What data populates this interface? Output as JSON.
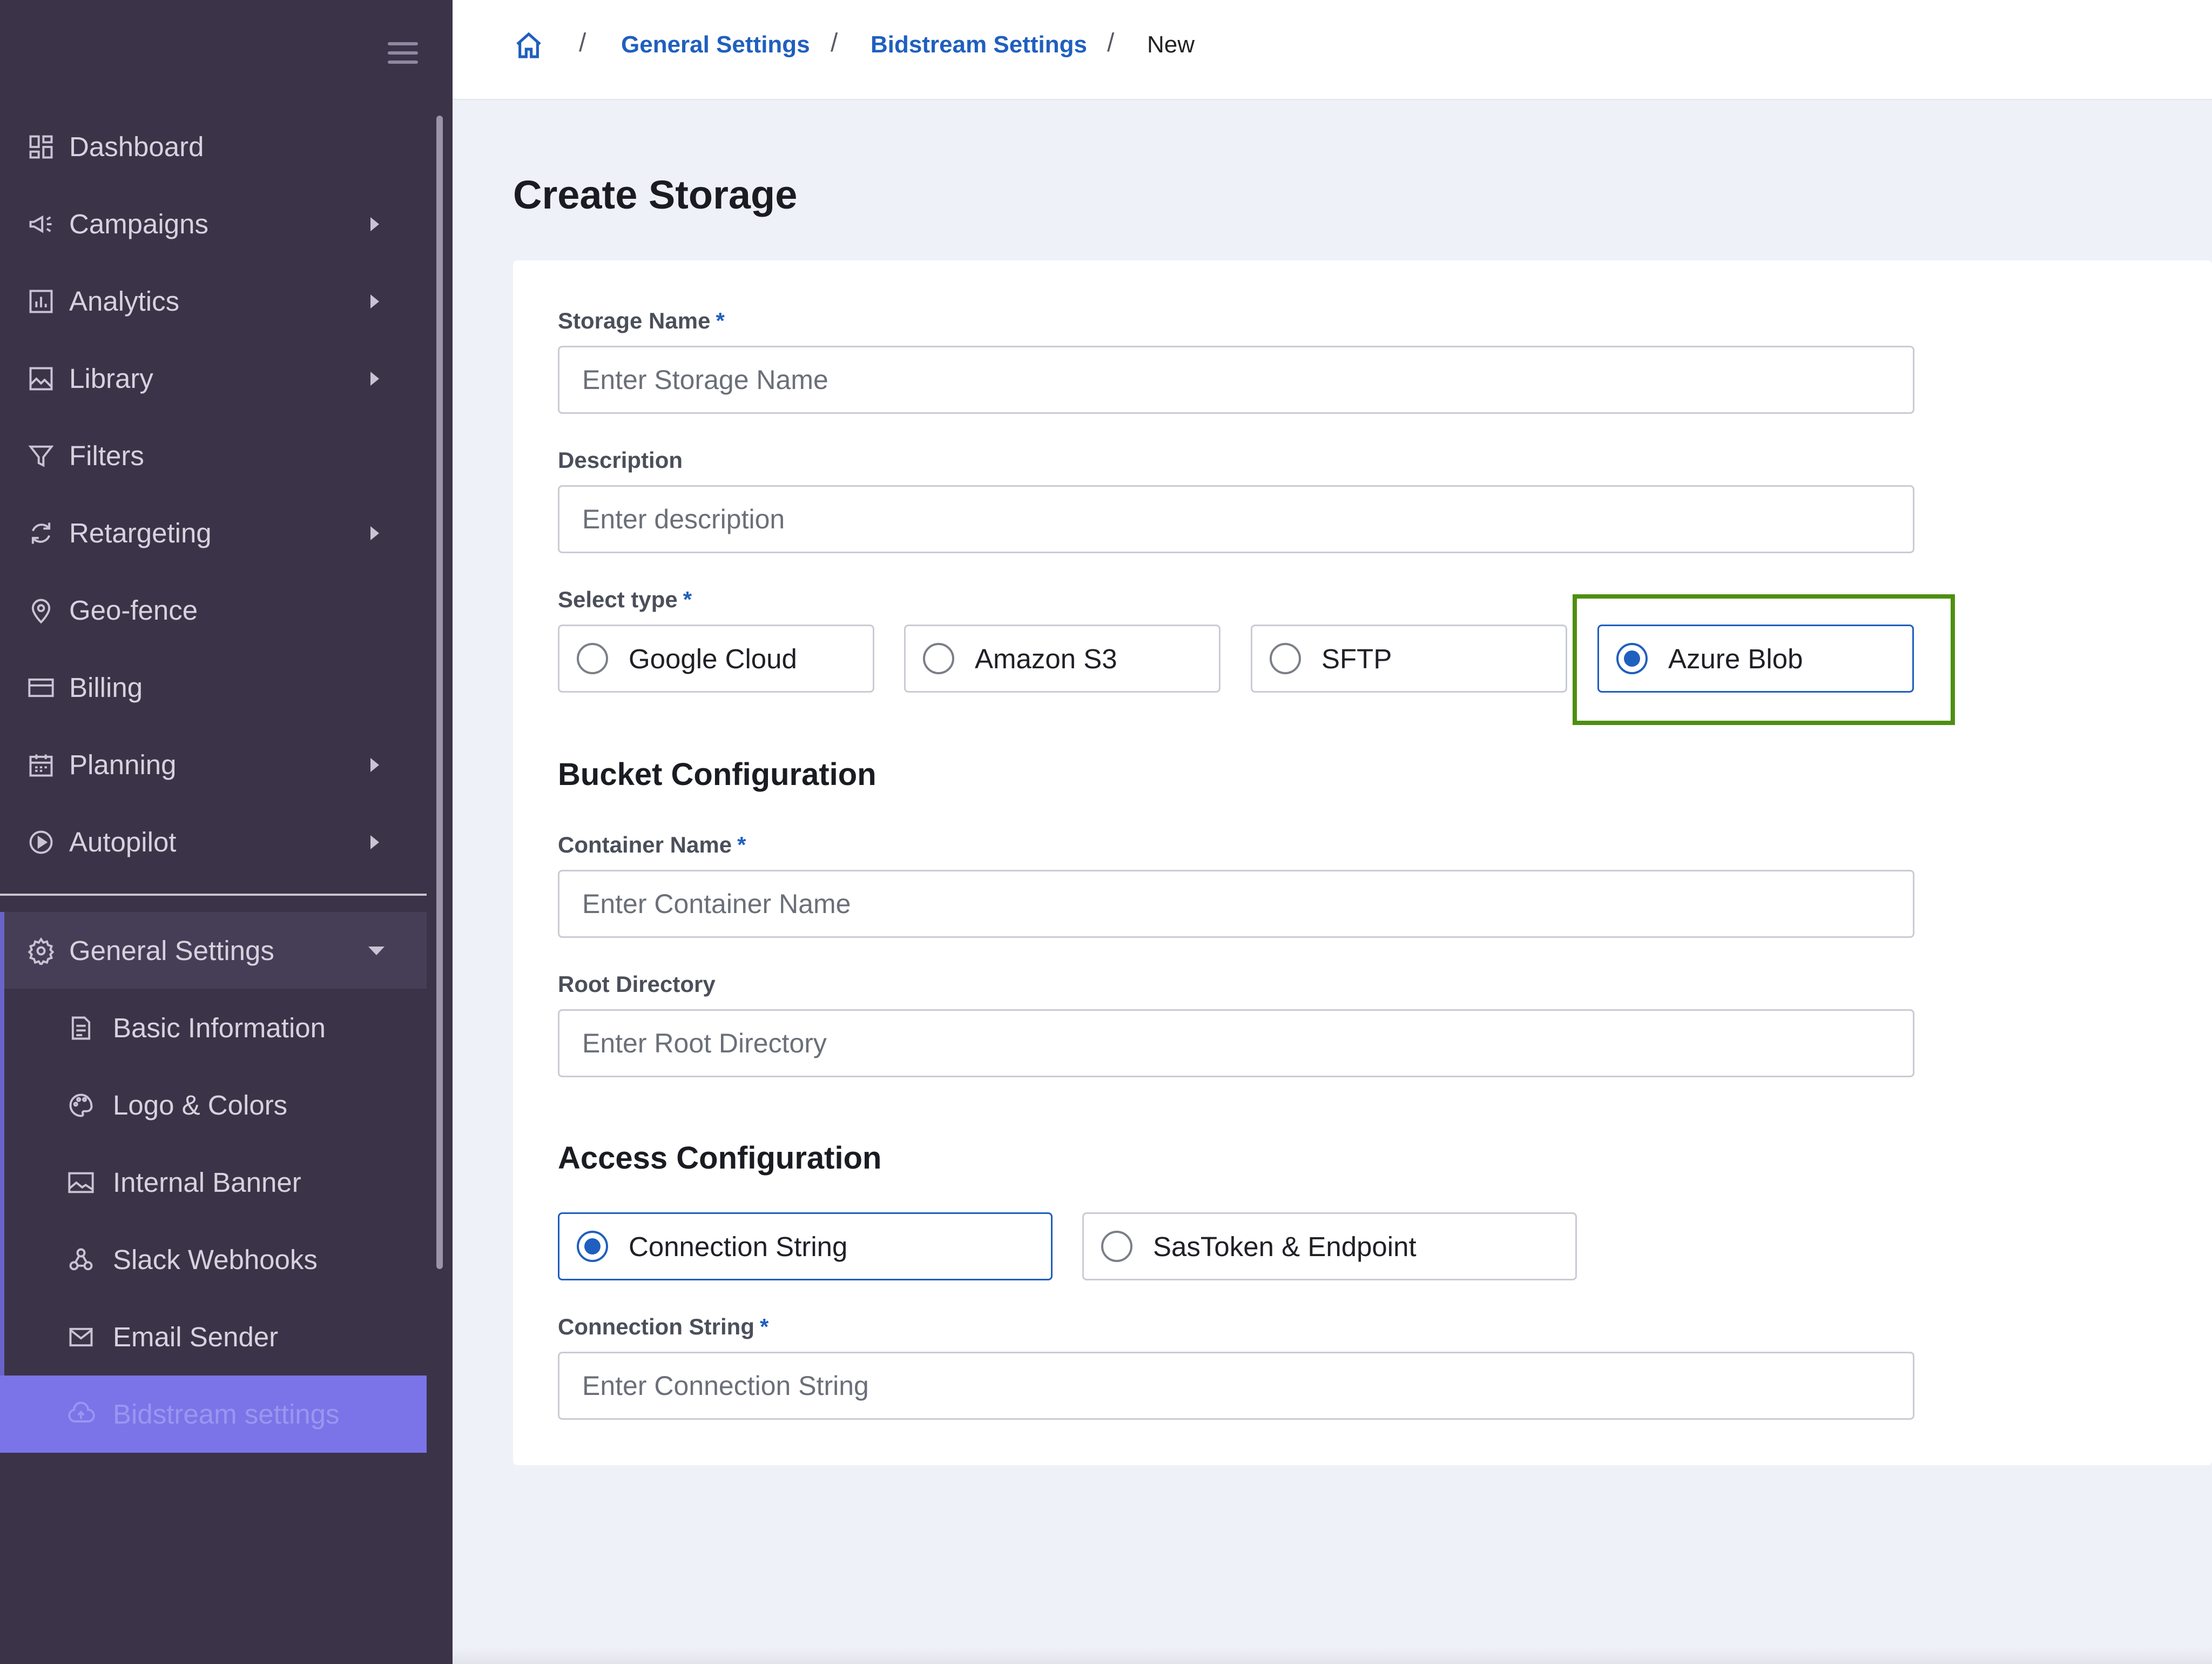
{
  "sidebar": {
    "items": [
      {
        "label": "Dashboard",
        "icon": "dashboard-icon"
      },
      {
        "label": "Campaigns",
        "icon": "megaphone-icon"
      },
      {
        "label": "Analytics",
        "icon": "bar-chart-icon"
      },
      {
        "label": "Library",
        "icon": "image-icon"
      },
      {
        "label": "Filters",
        "icon": "filter-icon"
      },
      {
        "label": "Retargeting",
        "icon": "refresh-icon"
      },
      {
        "label": "Geo-fence",
        "icon": "location-pin-icon"
      },
      {
        "label": "Billing",
        "icon": "credit-card-icon"
      },
      {
        "label": "Planning",
        "icon": "calendar-icon"
      },
      {
        "label": "Autopilot",
        "icon": "play-circle-icon"
      }
    ],
    "group": {
      "label": "General Settings",
      "icon": "gear-icon"
    },
    "sub_items": [
      {
        "label": "Basic Information",
        "icon": "document-icon"
      },
      {
        "label": "Logo & Colors",
        "icon": "palette-icon"
      },
      {
        "label": "Internal Banner",
        "icon": "image-icon"
      },
      {
        "label": "Slack Webhooks",
        "icon": "webhook-icon"
      },
      {
        "label": "Email Sender",
        "icon": "mail-icon"
      },
      {
        "label": "Bidstream settings",
        "icon": "cloud-upload-icon"
      }
    ]
  },
  "breadcrumb": {
    "items": [
      "General Settings",
      "Bidstream Settings"
    ],
    "current": "New",
    "separator": "/"
  },
  "page": {
    "title": "Create Storage"
  },
  "form": {
    "storage_name": {
      "label": "Storage Name",
      "placeholder": "Enter Storage Name",
      "required": "*"
    },
    "description": {
      "label": "Description",
      "placeholder": "Enter description"
    },
    "select_type": {
      "label": "Select type",
      "required": "*",
      "options": [
        "Google Cloud",
        "Amazon S3",
        "SFTP",
        "Azure Blob"
      ],
      "selected": "Azure Blob"
    },
    "bucket_section": "Bucket Configuration",
    "container_name": {
      "label": "Container Name",
      "placeholder": "Enter Container Name",
      "required": "*"
    },
    "root_directory": {
      "label": "Root Directory",
      "placeholder": "Enter Root Directory"
    },
    "access_section": "Access Configuration",
    "access_type": {
      "options": [
        "Connection String",
        "SasToken & Endpoint"
      ],
      "selected": "Connection String"
    },
    "connection_string": {
      "label": "Connection String",
      "placeholder": "Enter Connection String",
      "required": "*"
    }
  },
  "colors": {
    "sidebar_bg": "#3b3348",
    "accent": "#1f5fbf",
    "active_nav": "#7a74e8",
    "highlight": "#4e8f12"
  }
}
